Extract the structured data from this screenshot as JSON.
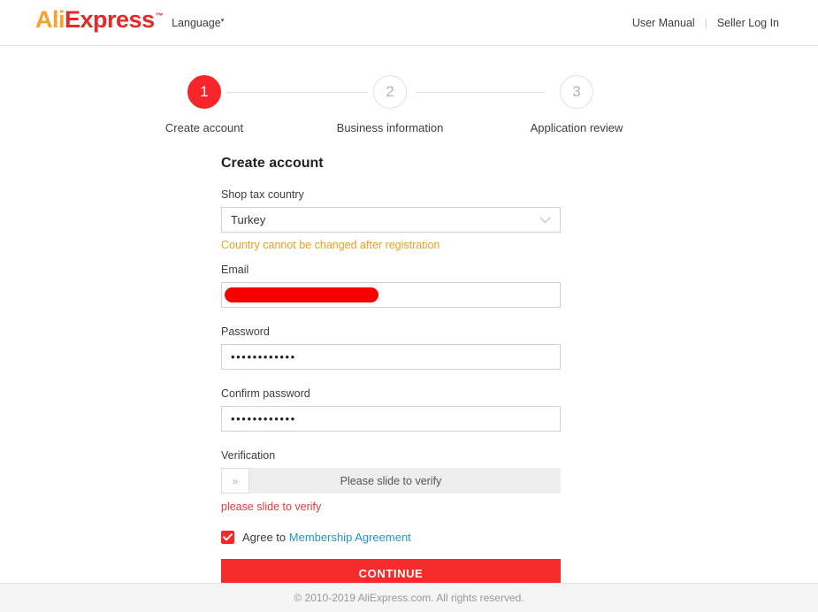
{
  "header": {
    "logo_ali": "Ali",
    "logo_express": "Express",
    "logo_tm": "™",
    "language_label": "Language",
    "language_mark": "▾",
    "user_manual": "User Manual",
    "separator": "|",
    "seller_login": "Seller Log In"
  },
  "stepper": {
    "steps": [
      {
        "number": "1",
        "label": "Create account",
        "state": "active"
      },
      {
        "number": "2",
        "label": "Business information",
        "state": "inactive"
      },
      {
        "number": "3",
        "label": "Application review",
        "state": "inactive"
      }
    ]
  },
  "form": {
    "title": "Create account",
    "country_label": "Shop tax country",
    "country_value": "Turkey",
    "country_warning": "Country cannot be changed after registration",
    "email_label": "Email",
    "email_value": "",
    "email_redacted": true,
    "password_label": "Password",
    "password_value": "••••••••••••",
    "confirm_password_label": "Confirm password",
    "confirm_password_value": "••••••••••••",
    "verification_label": "Verification",
    "slider_handle_glyph": "»",
    "slider_text": "Please slide to verify",
    "slider_error": "please slide to verify",
    "agree_prefix": "Agree to",
    "agree_link": "Membership Agreement",
    "agree_checked": true,
    "continue_label": "CONTINUE"
  },
  "footer": {
    "copyright": "© 2010-2019 AliExpress.com. All rights reserved."
  },
  "colors": {
    "brand_red": "#e42a28",
    "brand_orange": "#f7a32b",
    "active_step": "#f8262b",
    "warning": "#e8a317",
    "error": "#e4393c",
    "link": "#2196c4",
    "button": "#f62b2b",
    "redaction": "#f80000"
  }
}
